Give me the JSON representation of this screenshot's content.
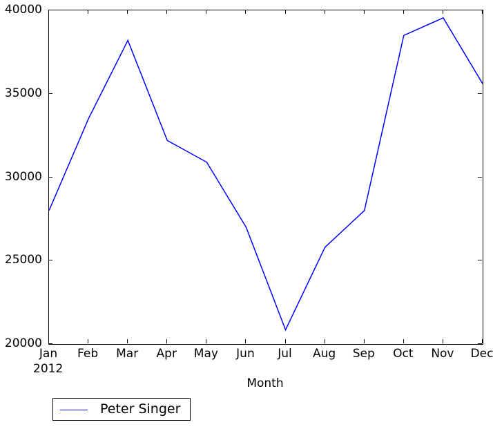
{
  "chart_data": {
    "type": "line",
    "title": "",
    "subtitle": "",
    "xlabel": "Month",
    "ylabel": "",
    "x_axis_year": "2012",
    "categories": [
      "Jan",
      "Feb",
      "Mar",
      "Apr",
      "May",
      "Jun",
      "Jul",
      "Aug",
      "Sep",
      "Oct",
      "Nov",
      "Dec"
    ],
    "xtick_labels": [
      "Jan",
      "Feb",
      "Mar",
      "Apr",
      "May",
      "Jun",
      "Jul",
      "Aug",
      "Sep",
      "Oct",
      "Nov",
      "Dec"
    ],
    "ytick_labels": [
      "20000",
      "25000",
      "30000",
      "35000",
      "40000"
    ],
    "ytick_values": [
      20000,
      25000,
      30000,
      35000,
      40000
    ],
    "ylim": [
      20000,
      40000
    ],
    "xlim": [
      0,
      11
    ],
    "grid": false,
    "legend_position": "below-left",
    "series": [
      {
        "name": "Peter Singer",
        "color": "#0000ff",
        "values": [
          28000,
          33500,
          38200,
          32200,
          30900,
          27000,
          20850,
          25800,
          28000,
          38500,
          39550,
          35600
        ]
      }
    ]
  },
  "legend": {
    "entries": [
      {
        "label": "Peter Singer",
        "color": "#0000ff"
      }
    ]
  },
  "axes": {
    "x_title": "Month",
    "x_year": "2012"
  }
}
